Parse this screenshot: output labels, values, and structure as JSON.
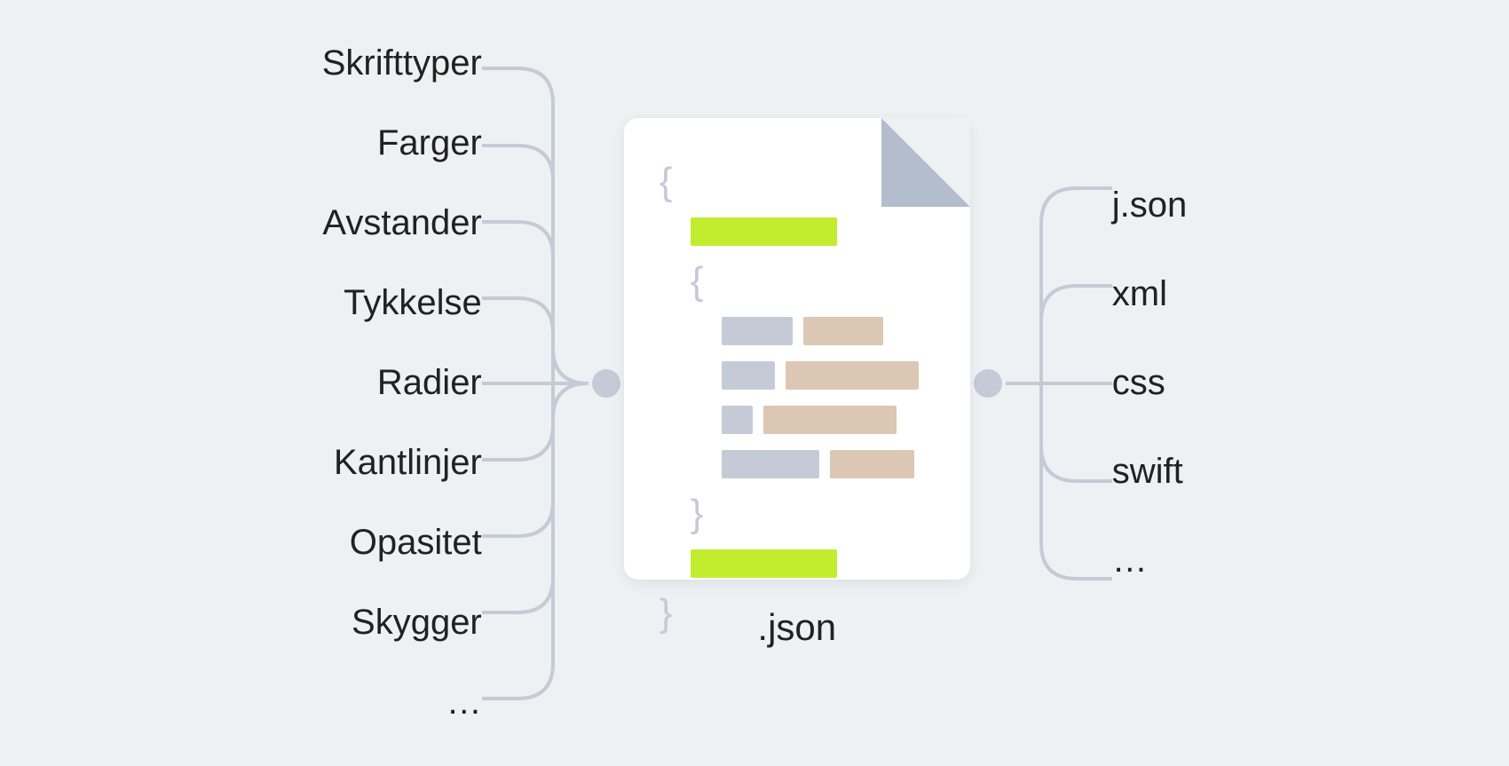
{
  "inputs": [
    "Skrifttyper",
    "Farger",
    "Avstander",
    "Tykkelse",
    "Radier",
    "Kantlinjer",
    "Opasitet",
    "Skygger",
    "…"
  ],
  "outputs": [
    "j.son",
    "xml",
    "css",
    "swift",
    "…"
  ],
  "file_label": ".json",
  "colors": {
    "background": "#eef1f4",
    "file_bg": "#ffffff",
    "fold": "#b3bdce",
    "brace": "#c5cbd6",
    "bar_green": "#c2ed2f",
    "bar_grey": "#c5cbd6",
    "bar_tan": "#dcc7b4",
    "connector": "#c5cbd6",
    "text": "#212121"
  }
}
